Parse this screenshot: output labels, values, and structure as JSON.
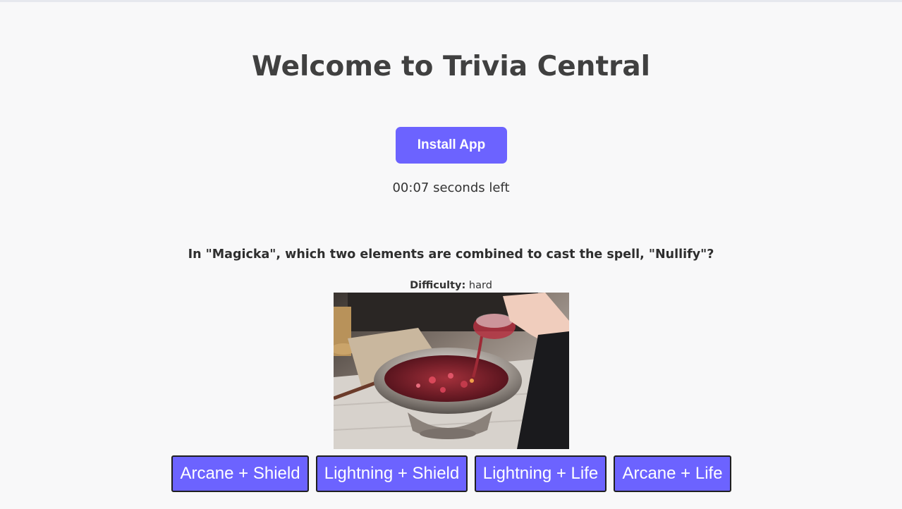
{
  "header": {
    "title": "Welcome to Trivia Central"
  },
  "install": {
    "label": "Install App"
  },
  "timer": {
    "text": "00:07 seconds left"
  },
  "question": {
    "text": "In \"Magicka\", which two elements are combined to cast the spell, \"Nullify\"?",
    "difficulty_label": "Difficulty:",
    "difficulty_value": "hard"
  },
  "answers": [
    {
      "label": "Arcane + Shield"
    },
    {
      "label": "Lightning + Shield"
    },
    {
      "label": "Lightning + Life"
    },
    {
      "label": "Arcane + Life"
    }
  ],
  "colors": {
    "accent": "#6c63ff",
    "background": "#f8f8f9",
    "button_border": "#1f1f1f"
  }
}
